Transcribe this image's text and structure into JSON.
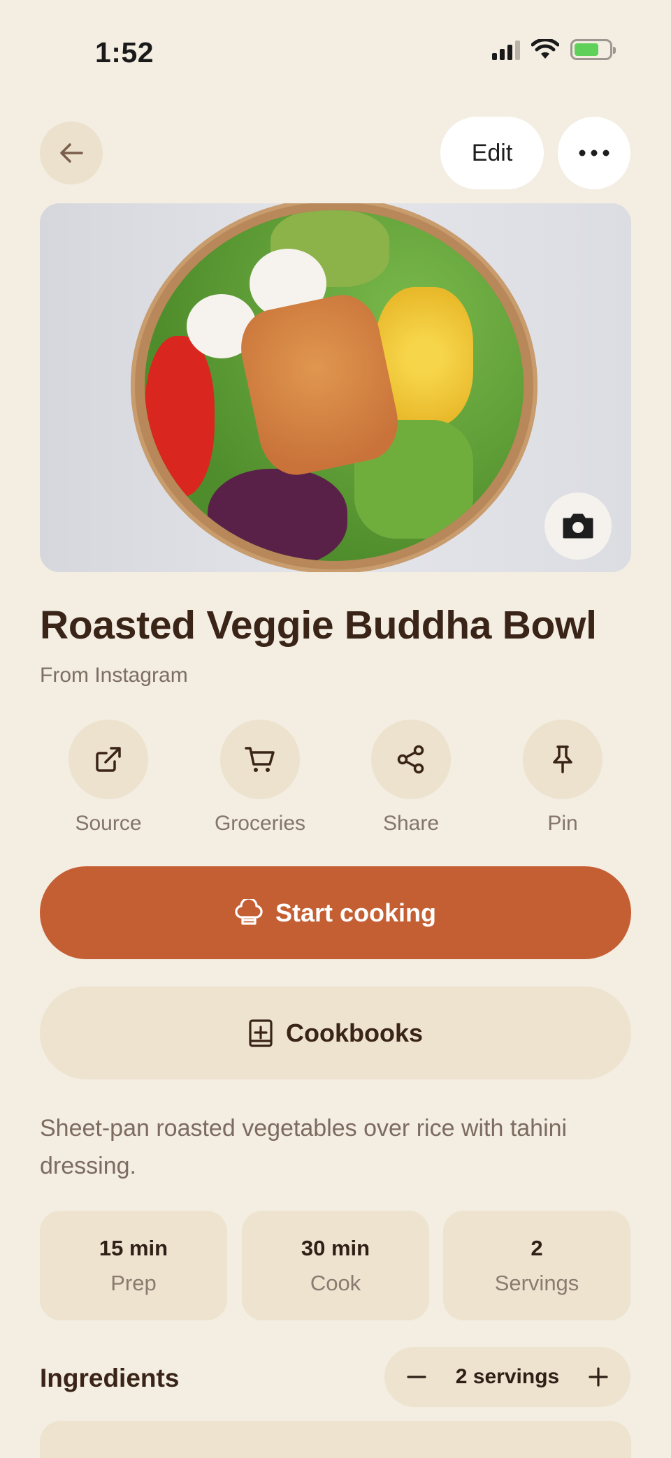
{
  "status_bar": {
    "time": "1:52"
  },
  "nav": {
    "edit_label": "Edit"
  },
  "recipe": {
    "title": "Roasted Veggie Buddha Bowl",
    "source": "From Instagram",
    "description": "Sheet-pan roasted vegetables over rice with tahini dressing."
  },
  "actions": [
    {
      "label": "Source",
      "icon": "external-link-icon"
    },
    {
      "label": "Groceries",
      "icon": "cart-icon"
    },
    {
      "label": "Share",
      "icon": "share-icon"
    },
    {
      "label": "Pin",
      "icon": "pin-icon"
    }
  ],
  "buttons": {
    "start_cooking": "Start cooking",
    "cookbooks": "Cookbooks"
  },
  "stats": [
    {
      "value": "15 min",
      "label": "Prep"
    },
    {
      "value": "30 min",
      "label": "Cook"
    },
    {
      "value": "2",
      "label": "Servings"
    }
  ],
  "ingredients": {
    "title": "Ingredients",
    "servings_label": "2 servings"
  },
  "colors": {
    "background": "#f3ede2",
    "accent": "#c45f33",
    "chip": "#ede3cf",
    "text": "#3a2418"
  }
}
